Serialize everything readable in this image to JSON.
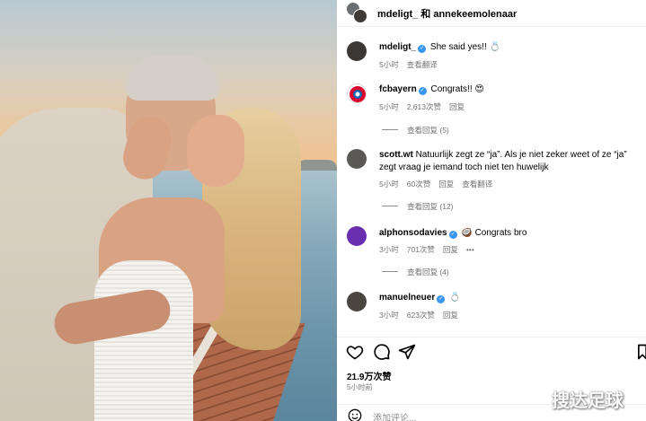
{
  "header": {
    "title": "mdeligt_ 和 annekeemolenaar"
  },
  "comments": [
    {
      "user": "mdeligt_",
      "verified": true,
      "text": "She said yes!! 💍",
      "time": "5小时",
      "actions": [
        "查看翻译"
      ],
      "replies": ""
    },
    {
      "user": "fcbayern",
      "verified": true,
      "text": "Congrats!! 😍",
      "time": "5小时",
      "actions": [
        "2,613次赞",
        "回复"
      ],
      "replies": "查看回复 (5)"
    },
    {
      "user": "scott.wt",
      "verified": false,
      "text": "Natuurlijk zegt ze “ja”. Als je niet zeker weet of ze “ja” zegt vraag je iemand toch niet ten huwelijk",
      "time": "5小时",
      "actions": [
        "60次赞",
        "回复",
        "查看翻译"
      ],
      "replies": "查看回复 (12)"
    },
    {
      "user": "alphonsodavies",
      "verified": true,
      "text": "🥥 Congrats bro",
      "time": "3小时",
      "actions": [
        "701次赞",
        "回复",
        "•••"
      ],
      "replies": "查看回复 (4)"
    },
    {
      "user": "manuelneuer",
      "verified": true,
      "text": "💍",
      "time": "3小时",
      "actions": [
        "623次赞",
        "回复"
      ],
      "replies": ""
    }
  ],
  "post": {
    "likes": "21.9万次赞",
    "time": "5小时前",
    "comment_placeholder": "添加评论..."
  },
  "watermark": "搜达足球",
  "colors": {
    "verified": "#3897f0",
    "meta": "#737373"
  }
}
